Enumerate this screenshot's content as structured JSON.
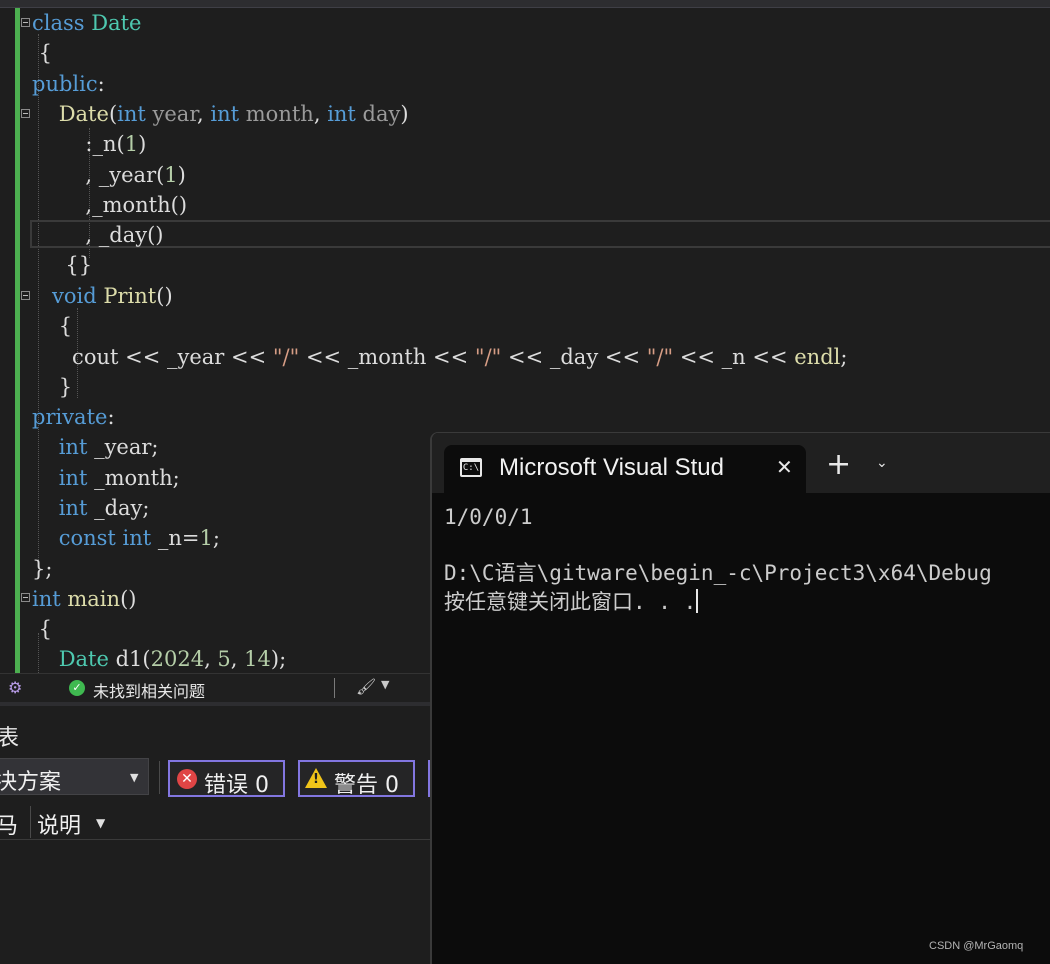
{
  "editor": {
    "lines": [
      [
        {
          "t": "class",
          "c": "kw"
        },
        {
          "t": " ",
          "c": "pl"
        },
        {
          "t": "Date",
          "c": "ty"
        }
      ],
      [
        {
          "t": " {",
          "c": "pl"
        }
      ],
      [
        {
          "t": "public",
          "c": "kw"
        },
        {
          "t": ":",
          "c": "pl"
        }
      ],
      [
        {
          "t": "    ",
          "c": "pl"
        },
        {
          "t": "Date",
          "c": "fn"
        },
        {
          "t": "(",
          "c": "pl"
        },
        {
          "t": "int",
          "c": "kw"
        },
        {
          "t": " year",
          "c": "pm"
        },
        {
          "t": ", ",
          "c": "pl"
        },
        {
          "t": "int",
          "c": "kw"
        },
        {
          "t": " month",
          "c": "pm"
        },
        {
          "t": ", ",
          "c": "pl"
        },
        {
          "t": "int",
          "c": "kw"
        },
        {
          "t": " day",
          "c": "pm"
        },
        {
          "t": ")",
          "c": "pl"
        }
      ],
      [
        {
          "t": "        :_n(",
          "c": "pl"
        },
        {
          "t": "1",
          "c": "nm"
        },
        {
          "t": ")",
          "c": "pl"
        }
      ],
      [
        {
          "t": "        , _year(",
          "c": "pl"
        },
        {
          "t": "1",
          "c": "nm"
        },
        {
          "t": ")",
          "c": "pl"
        }
      ],
      [
        {
          "t": "        ,_month()",
          "c": "pl"
        }
      ],
      [
        {
          "t": "        , _day()",
          "c": "pl"
        }
      ],
      [
        {
          "t": "     {}",
          "c": "pl"
        }
      ],
      [
        {
          "t": "   ",
          "c": "pl"
        },
        {
          "t": "void",
          "c": "kw"
        },
        {
          "t": " ",
          "c": "pl"
        },
        {
          "t": "Print",
          "c": "fn"
        },
        {
          "t": "()",
          "c": "pl"
        }
      ],
      [
        {
          "t": "    {",
          "c": "pl"
        }
      ],
      [
        {
          "t": "      cout << _year << ",
          "c": "pl"
        },
        {
          "t": "\"/\"",
          "c": "st"
        },
        {
          "t": " << _month << ",
          "c": "pl"
        },
        {
          "t": "\"/\"",
          "c": "st"
        },
        {
          "t": " << _day << ",
          "c": "pl"
        },
        {
          "t": "\"/\"",
          "c": "st"
        },
        {
          "t": " << _n << ",
          "c": "pl"
        },
        {
          "t": "endl",
          "c": "fn"
        },
        {
          "t": ";",
          "c": "pl"
        }
      ],
      [
        {
          "t": "    }",
          "c": "pl"
        }
      ],
      [
        {
          "t": "private",
          "c": "kw"
        },
        {
          "t": ":",
          "c": "pl"
        }
      ],
      [
        {
          "t": "    ",
          "c": "pl"
        },
        {
          "t": "int",
          "c": "kw"
        },
        {
          "t": " _year;",
          "c": "pl"
        }
      ],
      [
        {
          "t": "    ",
          "c": "pl"
        },
        {
          "t": "int",
          "c": "kw"
        },
        {
          "t": " _month;",
          "c": "pl"
        }
      ],
      [
        {
          "t": "    ",
          "c": "pl"
        },
        {
          "t": "int",
          "c": "kw"
        },
        {
          "t": " _day;",
          "c": "pl"
        }
      ],
      [
        {
          "t": "    ",
          "c": "pl"
        },
        {
          "t": "const",
          "c": "kw"
        },
        {
          "t": " ",
          "c": "pl"
        },
        {
          "t": "int",
          "c": "kw"
        },
        {
          "t": " _n=",
          "c": "pl"
        },
        {
          "t": "1",
          "c": "nm"
        },
        {
          "t": ";",
          "c": "pl"
        }
      ],
      [
        {
          "t": "};",
          "c": "pl"
        }
      ],
      [
        {
          "t": "int",
          "c": "kw"
        },
        {
          "t": " ",
          "c": "pl"
        },
        {
          "t": "main",
          "c": "fn"
        },
        {
          "t": "()",
          "c": "pl"
        }
      ],
      [
        {
          "t": " {",
          "c": "pl"
        }
      ],
      [
        {
          "t": "    ",
          "c": "pl"
        },
        {
          "t": "Date",
          "c": "ty"
        },
        {
          "t": " d1(",
          "c": "pl"
        },
        {
          "t": "2024",
          "c": "nm"
        },
        {
          "t": ", ",
          "c": "pl"
        },
        {
          "t": "5",
          "c": "nm"
        },
        {
          "t": ", ",
          "c": "pl"
        },
        {
          "t": "14",
          "c": "nm"
        },
        {
          "t": ");",
          "c": "pl"
        }
      ]
    ]
  },
  "statusbar": {
    "ai_icon": "copilot-icon",
    "status_icon": "check-circle-icon",
    "status_text": "未找到相关问题",
    "cleanup_icon": "brush-icon"
  },
  "error_list": {
    "title": "表",
    "scope_value": "决方案",
    "errors_label": "错误 0",
    "warnings_label": "警告 0",
    "col_code": "马",
    "col_description": "说明"
  },
  "terminal": {
    "tab_title": "Microsoft Visual Stud",
    "tab_icon": "cmd-icon",
    "output_line1": "1/0/0/1",
    "output_line2": "D:\\C语言\\gitware\\begin_-c\\Project3\\x64\\Debug",
    "output_line3": "按任意键关闭此窗口. . ."
  },
  "watermark": "CSDN @MrGaomq",
  "colors": {
    "keyword": "#569cd6",
    "type": "#4ec9b0",
    "function": "#dcdcaa",
    "param": "#9a9a9a",
    "number": "#b5cea8",
    "string": "#d69d85",
    "filter_border": "#8276e0",
    "change_bar": "#4caf50"
  }
}
